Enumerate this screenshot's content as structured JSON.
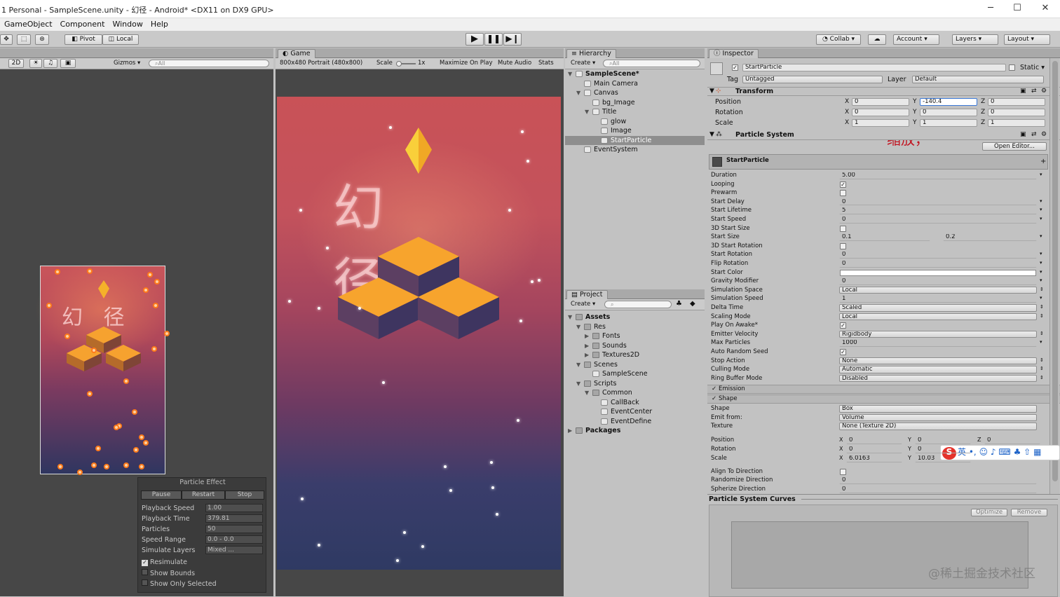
{
  "window": {
    "title": "1 Personal - SampleScene.unity - 幻径 - Android* <DX11 on DX9 GPU>",
    "minimize": "─",
    "maximize": "☐",
    "close": "✕"
  },
  "menu": [
    "GameObject",
    "Component",
    "Window",
    "Help"
  ],
  "toolbar": {
    "pivot": "Pivot",
    "local": "Local",
    "collab": "Collab ▾",
    "account": "Account",
    "layers": "Layers",
    "layout": "Layout"
  },
  "scene": {
    "mode_2d": "2D",
    "gizmos": "Gizmos",
    "search_placeholder": "All"
  },
  "scene_overlay_text": "幻  径",
  "particle_effect": {
    "title": "Particle Effect",
    "pause": "Pause",
    "restart": "Restart",
    "stop": "Stop",
    "rows": [
      {
        "label": "Playback Speed",
        "value": "1.00"
      },
      {
        "label": "Playback Time",
        "value": "379.81"
      },
      {
        "label": "Particles",
        "value": "50"
      },
      {
        "label": "Speed Range",
        "value": "0.0 - 0.0"
      },
      {
        "label": "Simulate Layers",
        "value": "Mixed ..."
      }
    ],
    "resimulate": "Resimulate",
    "show_bounds": "Show Bounds",
    "show_only_selected": "Show Only Selected"
  },
  "game": {
    "tab": "Game",
    "resolution": "800x480 Portrait (480x800)",
    "scale_label": "Scale",
    "scale_value": "1x",
    "maximize": "Maximize On Play",
    "mute": "Mute Audio",
    "stats": "Stats",
    "logo_text": "幻 径"
  },
  "hierarchy": {
    "tab": "Hierarchy",
    "create": "Create",
    "search": "All",
    "items": [
      {
        "label": "SampleScene*",
        "depth": 0
      },
      {
        "label": "Main Camera",
        "depth": 1
      },
      {
        "label": "Canvas",
        "depth": 1
      },
      {
        "label": "bg_Image",
        "depth": 2
      },
      {
        "label": "Title",
        "depth": 2
      },
      {
        "label": "glow",
        "depth": 3
      },
      {
        "label": "Image",
        "depth": 3
      },
      {
        "label": "StartParticle",
        "depth": 3
      },
      {
        "label": "EventSystem",
        "depth": 1
      }
    ]
  },
  "project": {
    "tab": "Project",
    "create": "Create",
    "items": [
      {
        "label": "Assets",
        "depth": 0
      },
      {
        "label": "Res",
        "depth": 1
      },
      {
        "label": "Fonts",
        "depth": 2
      },
      {
        "label": "Sounds",
        "depth": 2
      },
      {
        "label": "Textures2D",
        "depth": 2
      },
      {
        "label": "Scenes",
        "depth": 1
      },
      {
        "label": "SampleScene",
        "depth": 2
      },
      {
        "label": "Scripts",
        "depth": 1
      },
      {
        "label": "Common",
        "depth": 2
      },
      {
        "label": "CallBack",
        "depth": 3
      },
      {
        "label": "EventCenter",
        "depth": 3
      },
      {
        "label": "EventDefine",
        "depth": 3
      },
      {
        "label": "Packages",
        "depth": 0
      }
    ]
  },
  "inspector": {
    "tab": "Inspector",
    "name": "StartParticle",
    "static": "Static",
    "tag_label": "Tag",
    "tag": "Untagged",
    "layer_label": "Layer",
    "layer": "Default",
    "transform": {
      "title": "Transform",
      "position": {
        "label": "Position",
        "x": "0",
        "y": "-140.4",
        "z": "0"
      },
      "rotation": {
        "label": "Rotation",
        "x": "0",
        "y": "0",
        "z": "0"
      },
      "scale": {
        "label": "Scale",
        "x": "1",
        "y": "1",
        "z": "1"
      }
    },
    "annotation": "缩放，",
    "ps": {
      "title": "Particle System",
      "open_editor": "Open Editor...",
      "name": "StartParticle",
      "props": [
        {
          "label": "Duration",
          "value": "5.00"
        },
        {
          "label": "Looping",
          "value": "✓"
        },
        {
          "label": "Prewarm",
          "value": ""
        },
        {
          "label": "Start Delay",
          "value": "0"
        },
        {
          "label": "Start Lifetime",
          "value": "5"
        },
        {
          "label": "Start Speed",
          "value": "0"
        },
        {
          "label": "3D Start Size",
          "value": ""
        },
        {
          "label": "Start Size",
          "value": "0.1",
          "value2": "0.2"
        },
        {
          "label": "3D Start Rotation",
          "value": ""
        },
        {
          "label": "Start Rotation",
          "value": "0"
        },
        {
          "label": "Flip Rotation",
          "value": "0"
        },
        {
          "label": "Start Color",
          "value": ""
        },
        {
          "label": "Gravity Modifier",
          "value": "0"
        },
        {
          "label": "Simulation Space",
          "value": "Local"
        },
        {
          "label": "Simulation Speed",
          "value": "1"
        },
        {
          "label": "Delta Time",
          "value": "Scaled"
        },
        {
          "label": "Scaling Mode",
          "value": "Local"
        },
        {
          "label": "Play On Awake*",
          "value": "✓"
        },
        {
          "label": "Emitter Velocity",
          "value": "Rigidbody"
        },
        {
          "label": "Max Particles",
          "value": "1000"
        },
        {
          "label": "Auto Random Seed",
          "value": "✓"
        },
        {
          "label": "Stop Action",
          "value": "None"
        },
        {
          "label": "Culling Mode",
          "value": "Automatic"
        },
        {
          "label": "Ring Buffer Mode",
          "value": "Disabled"
        }
      ],
      "emission": "Emission",
      "shape": "Shape",
      "shape_props": [
        {
          "label": "Shape",
          "value": "Box"
        },
        {
          "label": "Emit from:",
          "value": "Volume"
        },
        {
          "label": "Texture",
          "value": "None (Texture 2D)"
        }
      ],
      "shape_pos": {
        "label": "Position",
        "x": "0",
        "y": "0",
        "z": "0"
      },
      "shape_rot": {
        "label": "Rotation",
        "x": "0",
        "y": "0"
      },
      "shape_scale": {
        "label": "Scale",
        "x": "6.0163",
        "y": "10.03"
      },
      "align": "Align To Direction",
      "randomize": {
        "label": "Randomize Direction",
        "value": "0"
      },
      "spherize": {
        "label": "Spherize Direction",
        "value": "0"
      }
    },
    "curves": {
      "title": "Particle System Curves",
      "optimize": "Optimize",
      "remove": "Remove"
    }
  },
  "ime": "英",
  "watermark": "@稀土掘金技术社区"
}
